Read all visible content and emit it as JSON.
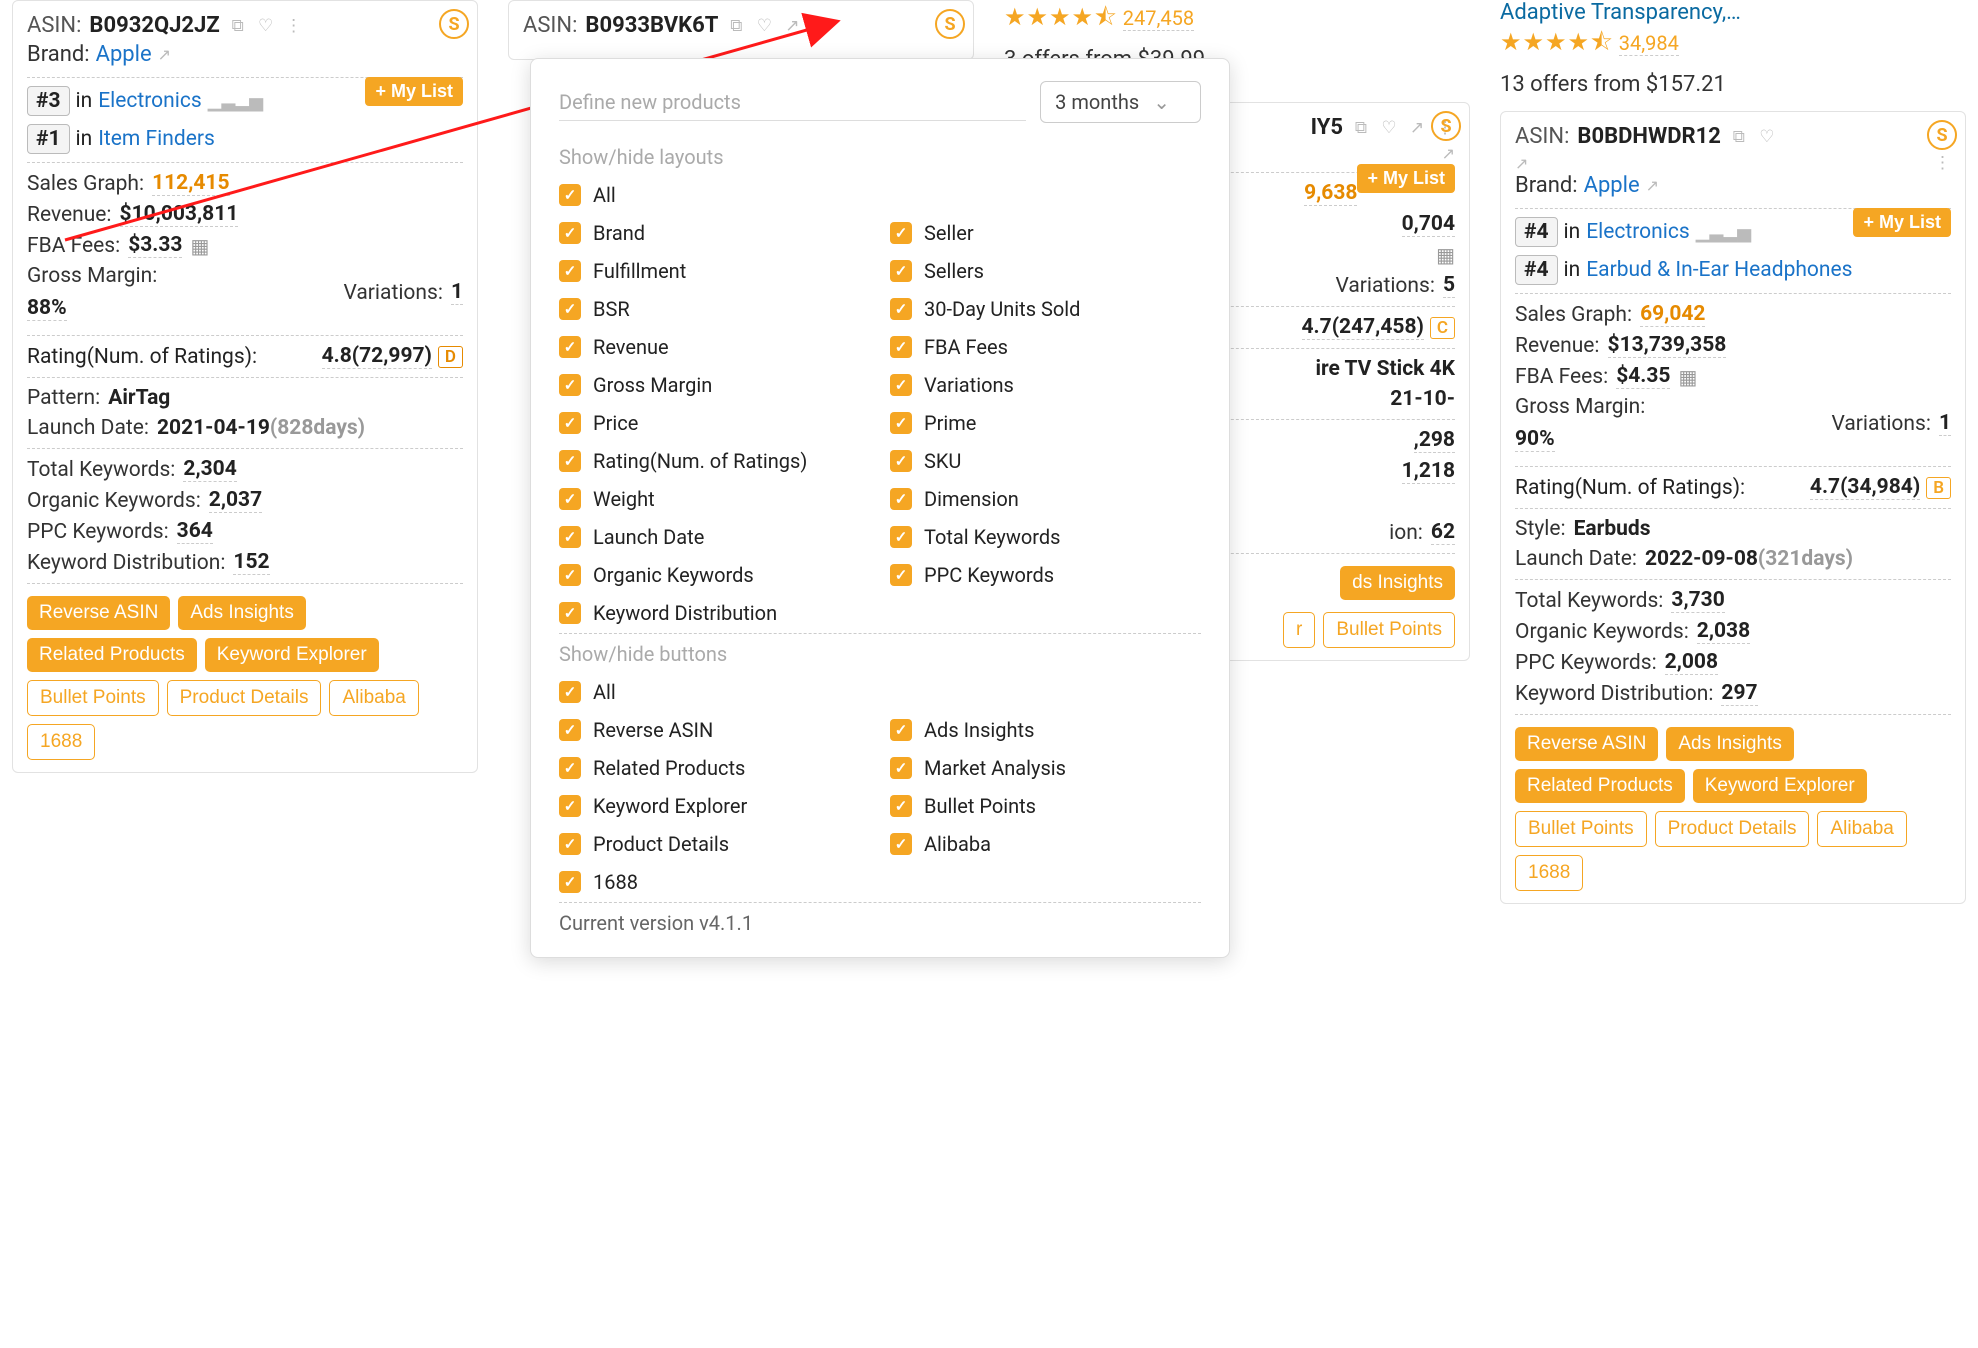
{
  "labels": {
    "asin": "ASIN:",
    "brand": "Brand:",
    "in": "in",
    "mylist": "+ My List",
    "sales_graph": "Sales Graph:",
    "revenue": "Revenue:",
    "fba_fees": "FBA Fees:",
    "gross_margin": "Gross Margin:",
    "variations": "Variations:",
    "rating_label": "Rating(Num. of Ratings):",
    "pattern": "Pattern:",
    "style": "Style:",
    "launch_date": "Launch Date:",
    "total_keywords": "Total Keywords:",
    "organic_keywords": "Organic Keywords:",
    "ppc_keywords": "PPC Keywords:",
    "keyword_distribution": "Keyword Distribution:"
  },
  "buttons": {
    "reverse_asin": "Reverse ASIN",
    "ads_insights": "Ads Insights",
    "related_products": "Related Products",
    "keyword_explorer": "Keyword Explorer",
    "bullet_points": "Bullet Points",
    "market_analysis": "Market Analysis",
    "product_details": "Product Details",
    "alibaba": "Alibaba",
    "1688": "1688"
  },
  "popup": {
    "define": "Define new products",
    "period": "3 months",
    "section_layouts": "Show/hide layouts",
    "section_buttons": "Show/hide buttons",
    "layouts": [
      "All",
      "Brand",
      "Seller",
      "Fulfillment",
      "Sellers",
      "BSR",
      "30-Day Units Sold",
      "Revenue",
      "FBA Fees",
      "Gross Margin",
      "Variations",
      "Price",
      "Prime",
      "Rating(Num. of Ratings)",
      "SKU",
      "Weight",
      "Dimension",
      "Launch Date",
      "Total Keywords",
      "Organic Keywords",
      "PPC Keywords",
      "Keyword Distribution"
    ],
    "btns": [
      "All",
      "Reverse ASIN",
      "Ads Insights",
      "Related Products",
      "Market Analysis",
      "Keyword Explorer",
      "Bullet Points",
      "Product Details",
      "Alibaba",
      "1688"
    ],
    "version": "Current version v4.1.1"
  },
  "card1": {
    "asin": "B0932QJ2JZ",
    "brand": "Apple",
    "rank1_badge": "#3",
    "rank1_cat": "Electronics",
    "rank2_badge": "#1",
    "rank2_cat": "Item Finders",
    "sales_graph": "112,415",
    "revenue": "$10,003,811",
    "fba_fees": "$3.33",
    "gross_margin": "88%",
    "variations": "1",
    "rating": "4.8(72,997)",
    "rating_grade": "D",
    "pattern": "AirTag",
    "launch_date": "2021-04-19",
    "launch_days": "(828days)",
    "total_kw": "2,304",
    "organic_kw": "2,037",
    "ppc_kw": "364",
    "kw_dist": "152"
  },
  "card2": {
    "asin": "B0933BVK6T"
  },
  "col3_top": {
    "reviews": "247,458",
    "offers": "3 offers from $39.99"
  },
  "card3": {
    "asin_suffix": "IY5",
    "bsr_a": "9,638",
    "bsr_b": "0,704",
    "variations": "5",
    "rating": "4.7(247,458)",
    "rating_grade": "C",
    "prod_name": "ire TV Stick 4K",
    "launch_date_frag": "21-10-",
    "kw_a": ",298",
    "kw_b": "1,218",
    "kw_c": "62",
    "btn_ads": "ds Insights"
  },
  "col4_top": {
    "title": "Adaptive Transparency,…",
    "reviews": "34,984",
    "offers": "13 offers from $157.21"
  },
  "card4": {
    "asin": "B0BDHWDR12",
    "brand": "Apple",
    "rank1_badge": "#4",
    "rank1_cat": "Electronics",
    "rank2_badge": "#4",
    "rank2_cat": "Earbud & In-Ear Headphones",
    "sales_graph": "69,042",
    "revenue": "$13,739,358",
    "fba_fees": "$4.35",
    "gross_margin": "90%",
    "variations": "1",
    "rating": "4.7(34,984)",
    "rating_grade": "B",
    "style": "Earbuds",
    "launch_date": "2022-09-08",
    "launch_days": "(321days)",
    "total_kw": "3,730",
    "organic_kw": "2,038",
    "ppc_kw": "2,008",
    "kw_dist": "297"
  }
}
